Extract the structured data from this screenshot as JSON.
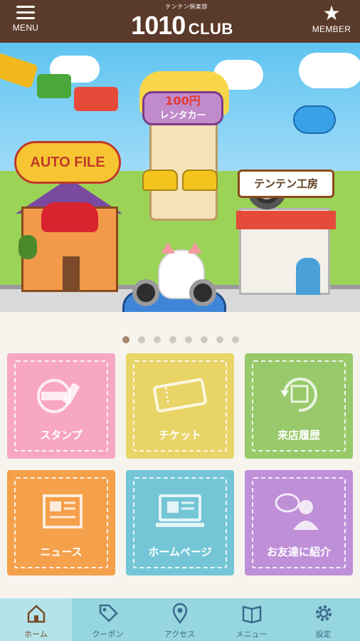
{
  "header": {
    "menu_label": "MENU",
    "member_label": "MEMBER",
    "logo_subtitle": "テンテン倶楽部",
    "logo_number": "1010",
    "logo_club": "CLUB"
  },
  "banner": {
    "autofile_sign": "AUTO FILE",
    "rental_price": "100円",
    "rental_label": "レンタカー",
    "koubou_sign": "テンテン工房"
  },
  "carousel": {
    "page_count": 8,
    "active_index": 0
  },
  "tiles": [
    {
      "label": "スタンプ",
      "icon": "stamp-icon",
      "color": "#f7a6c4"
    },
    {
      "label": "チケット",
      "icon": "ticket-icon",
      "color": "#e9d468"
    },
    {
      "label": "来店履歴",
      "icon": "shop-history-icon",
      "color": "#98c96a"
    },
    {
      "label": "ニュース",
      "icon": "newspaper-icon",
      "color": "#f5a04a"
    },
    {
      "label": "ホームページ",
      "icon": "computer-icon",
      "color": "#74c6d6"
    },
    {
      "label": "お友達に紹介",
      "icon": "friends-icon",
      "color": "#bf8fd8"
    }
  ],
  "tabbar": {
    "items": [
      {
        "label": "ホーム",
        "icon": "home-icon",
        "active": true
      },
      {
        "label": "クーポン",
        "icon": "coupon-tag-icon",
        "active": false
      },
      {
        "label": "アクセス",
        "icon": "location-pin-icon",
        "active": false
      },
      {
        "label": "メニュー",
        "icon": "menu-book-icon",
        "active": false
      },
      {
        "label": "設定",
        "icon": "gear-icon",
        "active": false
      }
    ]
  },
  "colors": {
    "header_bg": "#5a3a2a",
    "tabbar_bg": "#96d6df",
    "tabbar_active_bg": "#b4e4ea"
  }
}
